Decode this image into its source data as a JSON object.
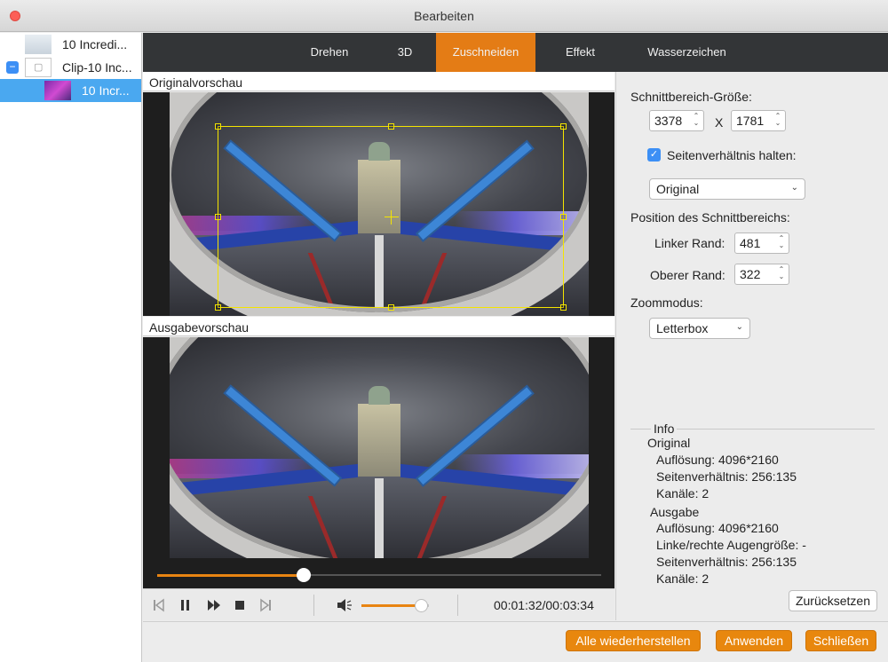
{
  "window": {
    "title": "Bearbeiten"
  },
  "sidebar": {
    "items": [
      {
        "label": "10 Incredi...",
        "selected": false
      },
      {
        "label": "Clip-10 Inc...",
        "selected": false
      },
      {
        "label": "10 Incr...",
        "selected": true
      }
    ]
  },
  "tabs": [
    {
      "label": "Drehen",
      "active": false
    },
    {
      "label": "3D",
      "active": false
    },
    {
      "label": "Zuschneiden",
      "active": true
    },
    {
      "label": "Effekt",
      "active": false
    },
    {
      "label": "Wasserzeichen",
      "active": false
    }
  ],
  "preview": {
    "original_label": "Originalvorschau",
    "output_label": "Ausgabevorschau"
  },
  "player": {
    "seek_progress": 0.33,
    "volume_level": 0.88,
    "timecode": "00:01:32/00:03:34"
  },
  "crop_panel": {
    "size_label": "Schnittbereich-Größe:",
    "width_value": "3378",
    "x_sep": "X",
    "height_value": "1781",
    "keep_ratio_label": "Seitenverhältnis halten:",
    "keep_ratio_checked": true,
    "ratio_value": "Original",
    "position_label": "Position des Schnittbereichs:",
    "left_label": "Linker Rand:",
    "left_value": "481",
    "top_label": "Oberer Rand:",
    "top_value": "322",
    "zoom_label": "Zoommodus:",
    "zoom_value": "Letterbox"
  },
  "info": {
    "title": "Info",
    "original_title": "Original",
    "original_resolution": "Auflösung: 4096*2160",
    "original_ratio": "Seitenverhältnis: 256:135",
    "original_channels": "Kanäle: 2",
    "output_title": "Ausgabe",
    "output_resolution": "Auflösung: 4096*2160",
    "output_eye": "Linke/rechte Augengröße: -",
    "output_ratio": "Seitenverhältnis: 256:135",
    "output_channels": "Kanäle: 2"
  },
  "buttons": {
    "reset": "Zurücksetzen",
    "restore_all": "Alle wiederherstellen",
    "apply": "Anwenden",
    "close": "Schließen"
  },
  "colors": {
    "accent": "#e47c15",
    "selection": "#4aa8f0",
    "crop_frame": "#f4e400"
  },
  "icons": {
    "prev": "skip-back-icon",
    "pause": "pause-icon",
    "forward": "fast-forward-icon",
    "stop": "stop-icon",
    "next": "skip-forward-icon",
    "volume": "speaker-icon"
  }
}
